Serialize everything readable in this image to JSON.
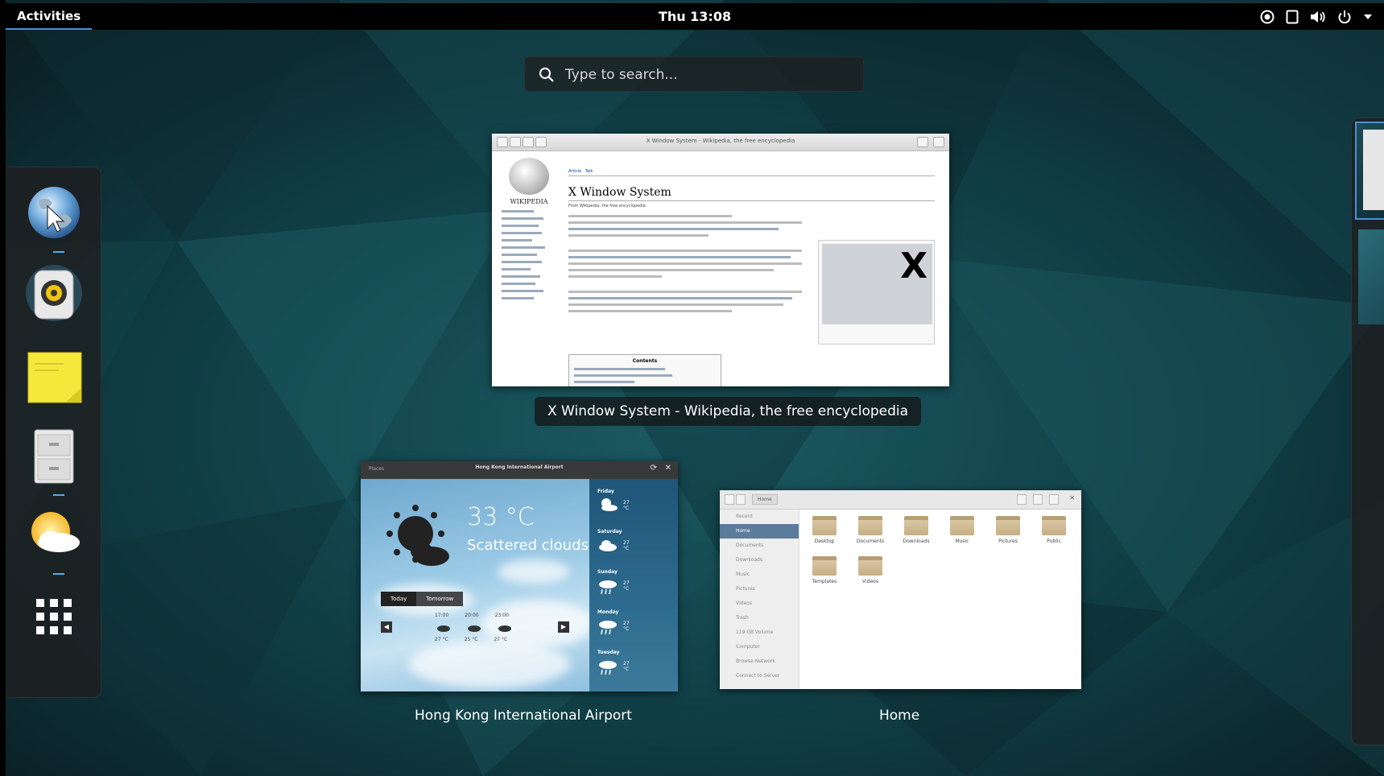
{
  "topbar": {
    "activities_label": "Activities",
    "clock": "Thu 13:08",
    "tray_icons": [
      "accessibility-icon",
      "screen-icon",
      "volume-icon",
      "power-icon",
      "chevron-down-icon"
    ]
  },
  "search": {
    "placeholder": "Type to search..."
  },
  "dash": {
    "apps": [
      {
        "icon": "web-browser-icon",
        "running": true
      },
      {
        "icon": "rhythmbox-icon",
        "running": false
      },
      {
        "icon": "notes-icon",
        "running": false
      },
      {
        "icon": "file-cabinet-icon",
        "running": true
      },
      {
        "icon": "weather-icon",
        "running": true
      },
      {
        "icon": "show-applications-icon",
        "running": false
      }
    ]
  },
  "windows": {
    "wikipedia": {
      "caption": "X Window System - Wikipedia, the free encyclopedia",
      "heading": "X Window System",
      "from": "From Wikipedia, the free encyclopedia",
      "logo": "WIKIPEDIA",
      "tab_article": "Article",
      "tab_talk": "Talk",
      "toc": "Contents"
    },
    "weather": {
      "caption": "Hong Kong International Airport",
      "title": "Hong Kong International Airport",
      "places_label": "Places",
      "temperature": "33 °C",
      "condition": "Scattered clouds",
      "tab_today": "Today",
      "tab_tomorrow": "Tomorrow",
      "hours": [
        "17:00",
        "20:00",
        "23:00"
      ],
      "hour_temps": [
        "27 °C",
        "25 °C",
        "27 °C"
      ],
      "forecast": [
        {
          "day": "Friday",
          "temp": "27 °C"
        },
        {
          "day": "Saturday",
          "temp": "27 °C"
        },
        {
          "day": "Sunday",
          "temp": "27 °C"
        },
        {
          "day": "Monday",
          "temp": "27 °C"
        },
        {
          "day": "Tuesday",
          "temp": "27 °C"
        }
      ]
    },
    "files": {
      "caption": "Home",
      "path_label": "Home",
      "sidebar": [
        "Recent",
        "Home",
        "Documents",
        "Downloads",
        "Music",
        "Pictures",
        "Videos",
        "Trash",
        "119 GB Volume",
        "Computer",
        "Browse Network",
        "Connect to Server"
      ],
      "folders": [
        "Desktop",
        "Documents",
        "Downloads",
        "Music",
        "Pictures",
        "Public",
        "Templates",
        "Videos"
      ]
    }
  },
  "colors": {
    "accent": "#4a90d9",
    "panel": "#000000",
    "background": "#0f3a40"
  }
}
